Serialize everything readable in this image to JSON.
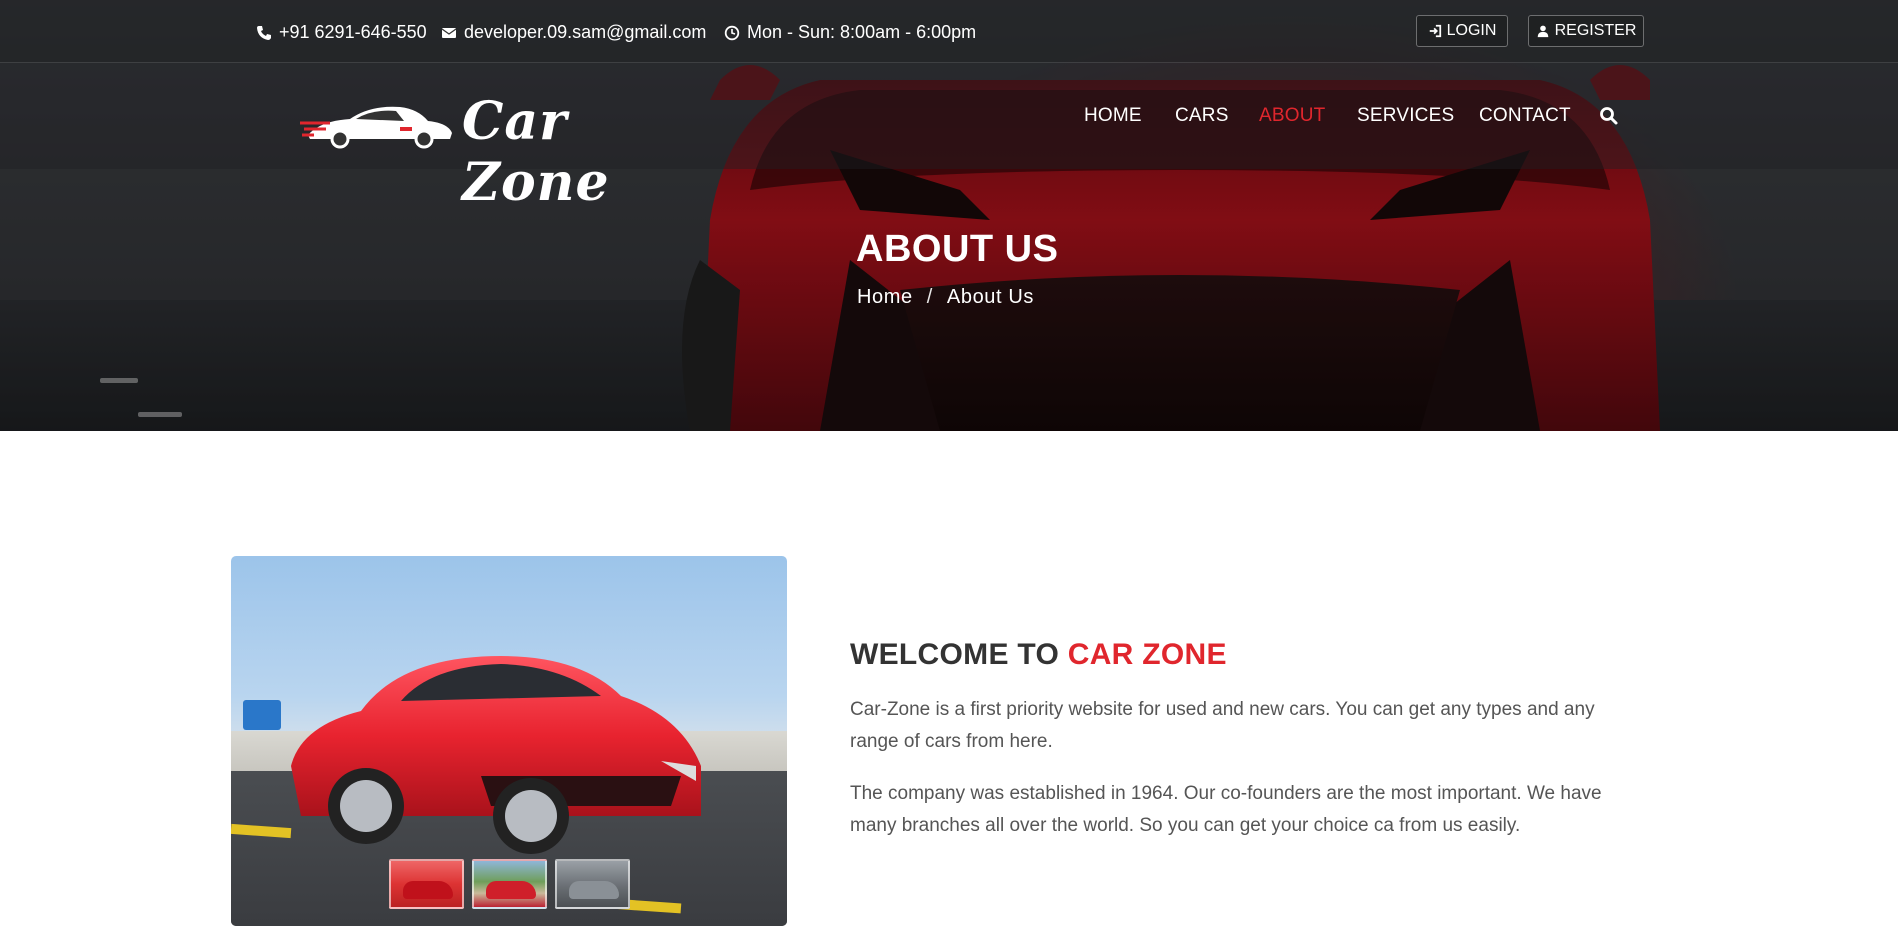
{
  "topbar": {
    "phone": "+91 6291-646-550",
    "email": "developer.09.sam@gmail.com",
    "hours": "Mon - Sun: 8:00am - 6:00pm",
    "login_label": "LOGIN",
    "register_label": "REGISTER"
  },
  "brand": {
    "name": "Car Zone"
  },
  "nav": {
    "items": [
      {
        "label": "HOME",
        "active": false
      },
      {
        "label": "CARS",
        "active": false
      },
      {
        "label": "ABOUT",
        "active": true
      },
      {
        "label": "SERVICES",
        "active": false
      },
      {
        "label": "CONTACT",
        "active": false
      }
    ]
  },
  "hero": {
    "title": "ABOUT US",
    "breadcrumb": {
      "home": "Home",
      "separator": "/",
      "current": "About Us"
    }
  },
  "about": {
    "heading_prefix": "WELCOME TO",
    "heading_accent": "CAR ZONE",
    "paragraphs": [
      "Car-Zone is a first priority website for used and new cars. You can get any types and any range of cars from here.",
      "The company was established in 1964. Our co-founders are the most important. We have many branches all over the world. So you can get your choice ca from us easily."
    ]
  },
  "colors": {
    "accent": "#e0262d",
    "text": "#333333",
    "muted": "#555555"
  }
}
